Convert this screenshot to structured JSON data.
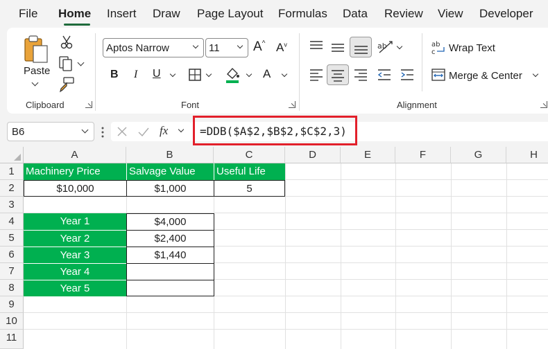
{
  "menu": {
    "tabs": [
      "File",
      "Home",
      "Insert",
      "Draw",
      "Page Layout",
      "Formulas",
      "Data",
      "Review",
      "View",
      "Developer"
    ],
    "active": "Home"
  },
  "ribbon": {
    "clipboard": {
      "paste_label": "Paste",
      "group_label": "Clipboard"
    },
    "font": {
      "font_name": "Aptos Narrow",
      "font_size": "11",
      "group_label": "Font"
    },
    "alignment": {
      "wrap_text": "Wrap Text",
      "merge_center": "Merge & Center",
      "group_label": "Alignment"
    }
  },
  "formula_bar": {
    "name_box": "B6",
    "formula": "=DDB($A$2,$B$2,$C$2,3)"
  },
  "sheet": {
    "columns": [
      "A",
      "B",
      "C",
      "D",
      "E",
      "F",
      "G",
      "H"
    ],
    "rows": [
      "1",
      "2",
      "3",
      "4",
      "5",
      "6",
      "7",
      "8",
      "9",
      "10",
      "11"
    ],
    "headers": {
      "machinery_price": "Machinery Price",
      "salvage_value": "Salvage Value",
      "useful_life": "Useful Life"
    },
    "inputs": {
      "machinery_price": "$10,000",
      "salvage_value": "$1,000",
      "useful_life": "5"
    },
    "years": [
      {
        "label": "Year 1",
        "value": "$4,000"
      },
      {
        "label": "Year 2",
        "value": "$2,400"
      },
      {
        "label": "Year 3",
        "value": "$1,440"
      },
      {
        "label": "Year 4",
        "value": ""
      },
      {
        "label": "Year 5",
        "value": ""
      }
    ]
  },
  "colors": {
    "accent_green": "#00b050",
    "highlight_red": "#e2202b",
    "tab_underline": "#1f6b3c"
  }
}
